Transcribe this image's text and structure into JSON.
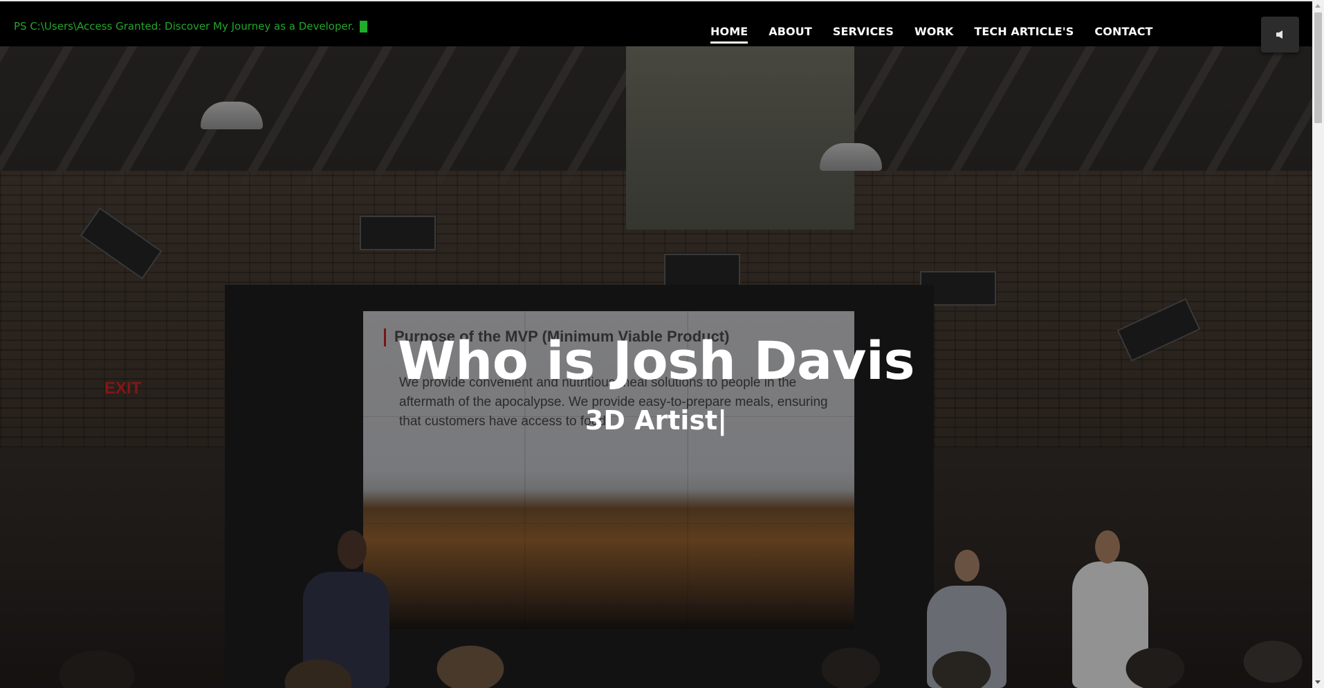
{
  "terminal": {
    "text": "PS C:\\Users\\Access Granted: Discover My Journey as a Developer."
  },
  "nav": {
    "items": [
      {
        "label": "HOME",
        "active": true
      },
      {
        "label": "ABOUT"
      },
      {
        "label": "SERVICES"
      },
      {
        "label": "WORK"
      },
      {
        "label": "TECH ARTICLE'S"
      },
      {
        "label": "CONTACT"
      }
    ]
  },
  "sound_button": {
    "icon": "speaker-icon"
  },
  "hero": {
    "title": "Who is Josh Davis",
    "subtitle": "3D Artist|",
    "background": {
      "slide_title": "Purpose of the MVP (Minimum Viable Product)",
      "slide_text": "We provide convenient and nutritious meal solutions to people in the aftermath of the apocalypse. We provide easy-to-prepare meals, ensuring that customers have access to food.",
      "exit_sign": "EXIT"
    }
  },
  "colors": {
    "terminal_green": "#22a62a",
    "nav_text": "#ffffff",
    "topbar_bg": "#000000"
  }
}
